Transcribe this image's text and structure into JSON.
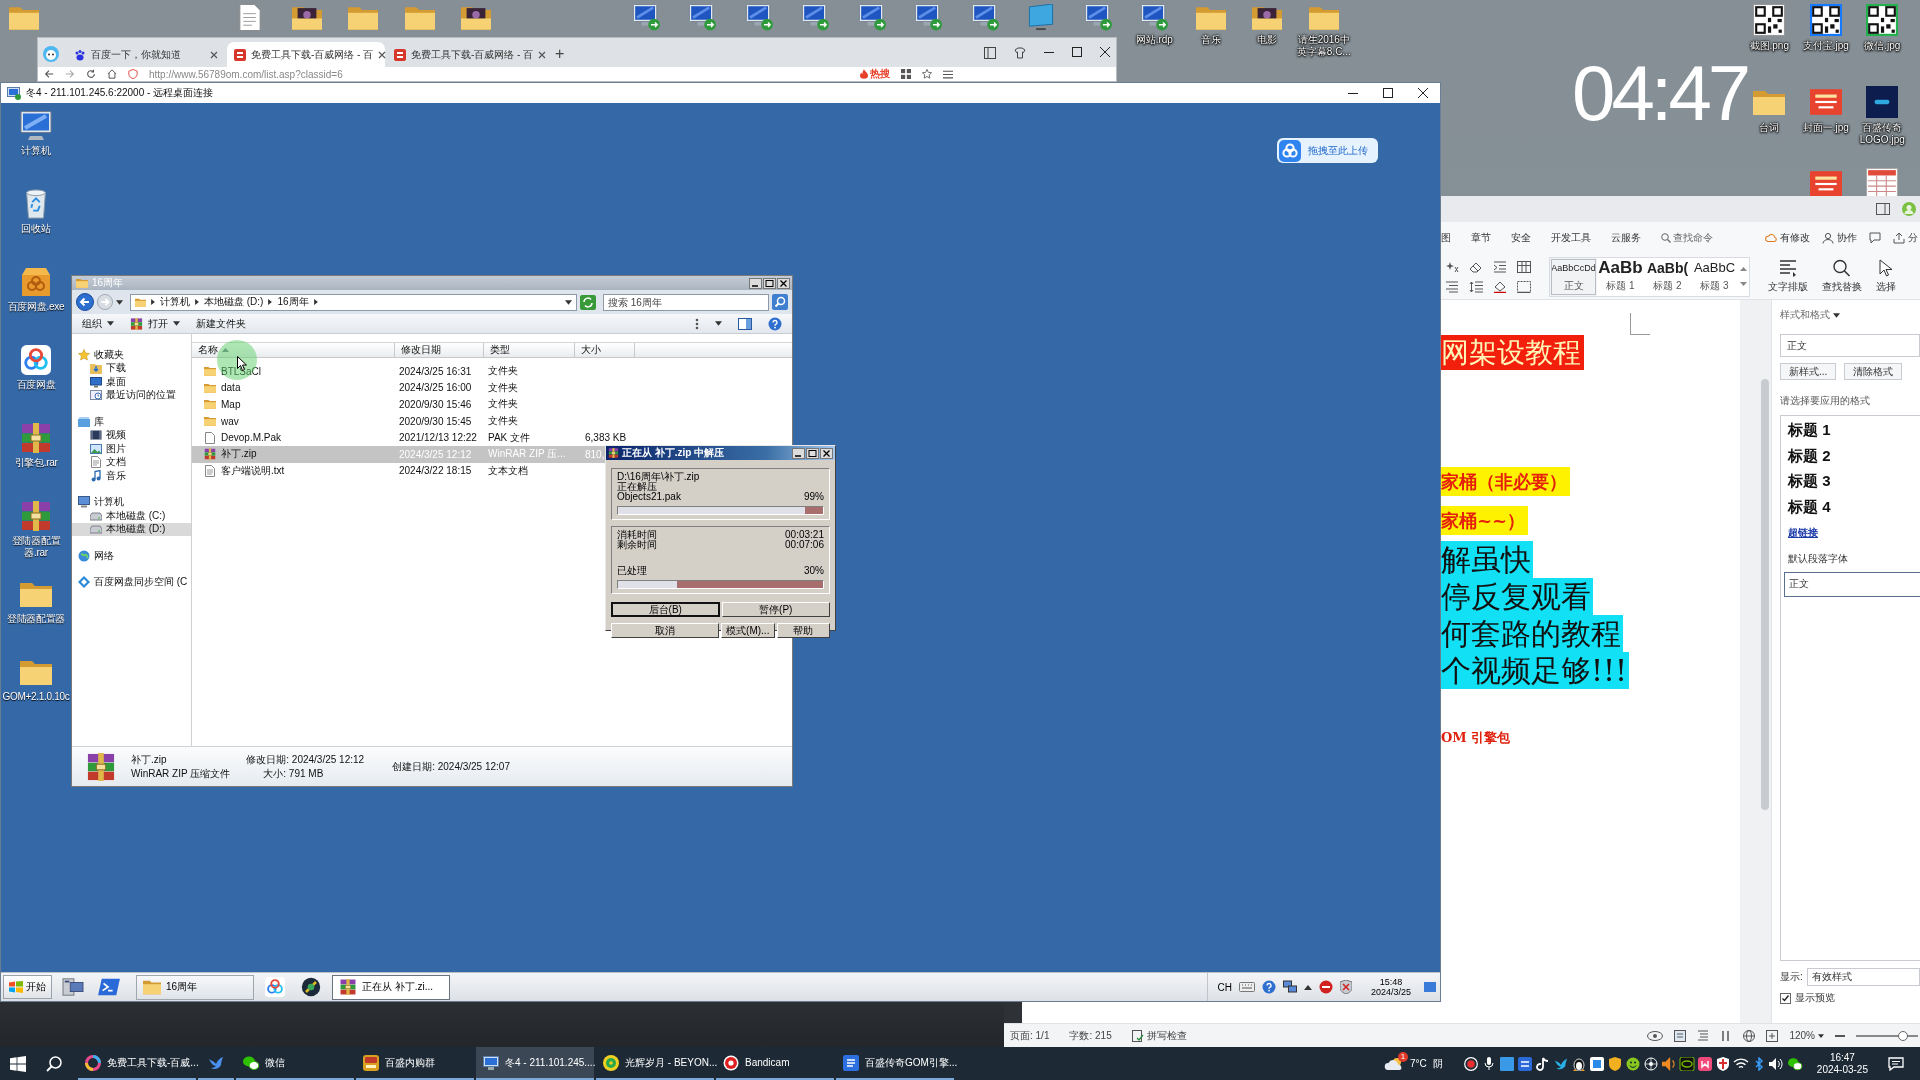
{
  "desktop": {
    "top_icons": [
      {
        "label": "网站.rdp",
        "kind": "monitor"
      },
      {
        "label": "音乐",
        "kind": "folder"
      },
      {
        "label": "电影",
        "kind": "darkfolder"
      },
      {
        "label": "请生2016中英字幕8.C...",
        "kind": "folder"
      }
    ],
    "side_icons": [
      {
        "label": "截图.png",
        "kind": "qr"
      },
      {
        "label": "支付宝.jpg",
        "kind": "qrblue"
      },
      {
        "label": "微信.jpg",
        "kind": "qrgreen"
      },
      {
        "label": "台词",
        "kind": "folder"
      },
      {
        "label": "封面一.jpg",
        "kind": "poster"
      },
      {
        "label": "百盛传奇LOGO.jpg",
        "kind": "tile"
      }
    ],
    "clock": "04:47"
  },
  "browser": {
    "tabs": [
      {
        "label": "百度一下，你就知道",
        "kind": "paw",
        "selected": false
      },
      {
        "label": "免费工具下载-百威网络 - 百",
        "kind": "redtile",
        "selected": true
      },
      {
        "label": "免费工具下载-百威网络 - 百",
        "kind": "redtile",
        "selected": false
      }
    ],
    "new_tab": "+",
    "url": "http://www.56789om.com/list.asp?classid=6",
    "hot": "热搜"
  },
  "remote": {
    "title": "冬4 - 211.101.245.6:22000 - 远程桌面连接",
    "icons": [
      {
        "label": "计算机",
        "kind": "pc"
      },
      {
        "label": "回收站",
        "kind": "bin"
      },
      {
        "label": "百度网盘.exe",
        "kind": "box"
      },
      {
        "label": "百度网盘",
        "kind": "cloud"
      },
      {
        "label": "引擎包.rar",
        "kind": "archive"
      },
      {
        "label": "登陆器配置器.rar",
        "kind": "archive"
      },
      {
        "label": "登陆器配置器",
        "kind": "folder"
      },
      {
        "label": "GOM+2.1.0.10c",
        "kind": "folder"
      }
    ],
    "upload": "拖拽至此上传",
    "explorer": {
      "title": "16周年",
      "path": [
        "计算机",
        "本地磁盘 (D:)",
        "16周年"
      ],
      "search": {
        "placeholder": "搜索 16周年"
      },
      "toolbar": [
        {
          "label": "组织",
          "kind": "organize"
        },
        {
          "label": "打开",
          "kind": "open"
        },
        {
          "label": "新建文件夹",
          "kind": "newfolder"
        }
      ],
      "nav": [
        {
          "label": "收藏夹",
          "kind": "star",
          "selected": false,
          "children": [
            {
              "label": "下载",
              "kind": "download",
              "selected": false
            },
            {
              "label": "桌面",
              "kind": "desktop",
              "selected": false
            },
            {
              "label": "最近访问的位置",
              "kind": "recent",
              "selected": false
            }
          ]
        },
        {
          "label": "库",
          "kind": "library",
          "selected": false,
          "children": [
            {
              "label": "视频",
              "kind": "video",
              "selected": false
            },
            {
              "label": "图片",
              "kind": "picture",
              "selected": false
            },
            {
              "label": "文档",
              "kind": "document",
              "selected": false
            },
            {
              "label": "音乐",
              "kind": "music",
              "selected": false
            }
          ]
        },
        {
          "label": "计算机",
          "kind": "computer",
          "selected": false,
          "children": [
            {
              "label": "本地磁盘 (C:)",
              "kind": "drive",
              "selected": false
            },
            {
              "label": "本地磁盘 (D:)",
              "kind": "drive",
              "selected": true
            }
          ]
        },
        {
          "label": "网络",
          "kind": "network",
          "selected": false
        },
        {
          "label": "百度网盘同步空间 (C",
          "kind": "sync",
          "selected": false
        }
      ],
      "columns": [
        "名称",
        "修改日期",
        "类型",
        "大小"
      ],
      "rows": [
        {
          "name": "BTLSaCl",
          "date": "2024/3/25 16:31",
          "type": "文件夹",
          "kind": "folder",
          "selected": false
        },
        {
          "name": "data",
          "date": "2024/3/25 16:00",
          "type": "文件夹",
          "kind": "folder",
          "selected": false
        },
        {
          "name": "Map",
          "date": "2020/9/30 15:46",
          "type": "文件夹",
          "kind": "folder",
          "selected": false
        },
        {
          "name": "wav",
          "date": "2020/9/30 15:45",
          "type": "文件夹",
          "kind": "folder",
          "selected": false
        },
        {
          "name": "Devop.M.Pak",
          "date": "2021/12/13 12:22",
          "type": "PAK 文件",
          "size": "6,383 KB",
          "kind": "file",
          "selected": false
        },
        {
          "name": "补丁.zip",
          "date": "2024/3/25 12:12",
          "type": "WinRAR ZIP 压...",
          "size": "810,",
          "kind": "archive",
          "selected": true
        },
        {
          "name": "客户端说明.txt",
          "date": "2024/3/22 18:15",
          "type": "文本文档",
          "kind": "text",
          "selected": false
        }
      ],
      "details": {
        "name": "补丁.zip",
        "type": "WinRAR ZIP 压缩文件",
        "modified": "修改日期: 2024/3/25 12:12",
        "size": "大小: 791 MB",
        "created": "创建日期: 2024/3/25 12:07"
      }
    },
    "dialog": {
      "title": "正在从 补丁.zip 中解压",
      "archive": "D:\\16周年\\补丁.zip",
      "action": "正在解压",
      "file": "Objects21.pak",
      "file_progress": {
        "reading": "99%",
        "level": 0.91
      },
      "times": [
        {
          "label": "消耗时间",
          "value": "00:03:21"
        },
        {
          "label": "剩余时间",
          "value": "00:07:06"
        }
      ],
      "total_progress": {
        "label": "已处理",
        "reading": "30%",
        "level": 0.29
      },
      "buttons": [
        {
          "label": "后台(B)",
          "focused": true
        },
        {
          "label": "暂停(P)",
          "focused": false
        },
        {
          "label": "取消",
          "focused": false
        },
        {
          "label": "模式(M)...",
          "focused": false
        },
        {
          "label": "帮助",
          "focused": false
        }
      ]
    },
    "taskbar": {
      "start": "开始",
      "items": [
        {
          "kind": "server",
          "selected": false
        },
        {
          "kind": "shell",
          "selected": false
        },
        {
          "label": "16周年",
          "kind": "explorer",
          "selected": false
        },
        {
          "kind": "cloud",
          "selected": false
        },
        {
          "kind": "emblem",
          "selected": false
        },
        {
          "label": "正在从 补丁.zi...",
          "kind": "archive",
          "selected": true
        }
      ],
      "lang": "CH",
      "time": "15:48",
      "date": "2024/3/25"
    }
  },
  "wps": {
    "tabs": [
      {
        "label": "图",
        "selected": false
      },
      {
        "label": "章节",
        "selected": false
      },
      {
        "label": "安全",
        "selected": false
      },
      {
        "label": "开发工具",
        "selected": false
      },
      {
        "label": "云服务",
        "selected": false
      }
    ],
    "command_search": "查找命令",
    "actions": [
      {
        "label": "有修改",
        "kind": "changes"
      },
      {
        "label": "协作",
        "kind": "collab"
      },
      {
        "kind": "comment"
      },
      {
        "label": "分",
        "kind": "share"
      }
    ],
    "gallery": [
      {
        "sample": "AaBbCcDd",
        "label": "正文",
        "selected": true
      },
      {
        "sample": "AaBb",
        "label": "标题 1",
        "selected": false
      },
      {
        "sample": "AaBb(",
        "label": "标题 2",
        "selected": false
      },
      {
        "sample": "AaBbC",
        "label": "标题 3",
        "selected": false
      }
    ],
    "tools": [
      {
        "label": "文字排版",
        "kind": "layout"
      },
      {
        "label": "查找替换",
        "kind": "find"
      },
      {
        "label": "选择",
        "kind": "select"
      }
    ],
    "document": [
      {
        "text": "网架设教程",
        "kind": "banner"
      },
      {
        "text": "家桶（非必要）",
        "kind": "note"
      },
      {
        "text": "家桶~~）",
        "kind": "note"
      },
      {
        "text": "解虽快",
        "kind": "highlight"
      },
      {
        "text": "停反复观看",
        "kind": "highlight"
      },
      {
        "text": "何套路的教程",
        "kind": "highlight"
      },
      {
        "text": "个视频足够!!!",
        "kind": "highlight"
      },
      {
        "text": "OM 引擎包",
        "kind": "red"
      }
    ],
    "styles": {
      "title": "样式和格式",
      "current": "正文",
      "buttons": [
        "新样式...",
        "清除格式"
      ],
      "prompt": "请选择要应用的格式",
      "items": [
        {
          "label": "标题 1",
          "kind": "heading",
          "selected": false
        },
        {
          "label": "标题 2",
          "kind": "heading",
          "selected": false
        },
        {
          "label": "标题 3",
          "kind": "heading",
          "selected": false
        },
        {
          "label": "标题 4",
          "kind": "heading",
          "selected": false
        },
        {
          "label": "超链接",
          "kind": "link",
          "selected": false
        },
        {
          "label": "默认段落字体",
          "kind": "plain",
          "selected": false
        },
        {
          "label": "正文",
          "kind": "plain",
          "selected": true
        }
      ],
      "show_label": "显示:",
      "show_value": "有效样式",
      "preview": {
        "label": "显示预览",
        "checked": true
      }
    },
    "status": {
      "page": "页面: 1/1",
      "words": "字数: 215",
      "spell": "拼写检查",
      "zoom": "120%",
      "zoom_slider": {
        "level": 0.75
      }
    }
  },
  "taskbar": {
    "apps": [
      {
        "label": "免费工具下载-百威...",
        "kind": "browser",
        "selected": false
      },
      {
        "kind": "bird",
        "selected": false
      },
      {
        "label": "微信",
        "kind": "wechat",
        "selected": false
      },
      {
        "label": "百盛内购群",
        "kind": "group",
        "selected": false
      },
      {
        "label": "冬4 - 211.101.245....",
        "kind": "remote",
        "selected": true
      },
      {
        "label": "光辉岁月 - BEYON...",
        "kind": "music",
        "selected": false
      },
      {
        "label": "Bandicam",
        "kind": "record",
        "selected": false
      },
      {
        "label": "百盛传奇GOM引擎...",
        "kind": "word",
        "selected": false
      }
    ],
    "weather": {
      "badge": "1",
      "temp": "7°C",
      "sky": "阴"
    },
    "time": "16:47",
    "date": "2024-03-25"
  }
}
